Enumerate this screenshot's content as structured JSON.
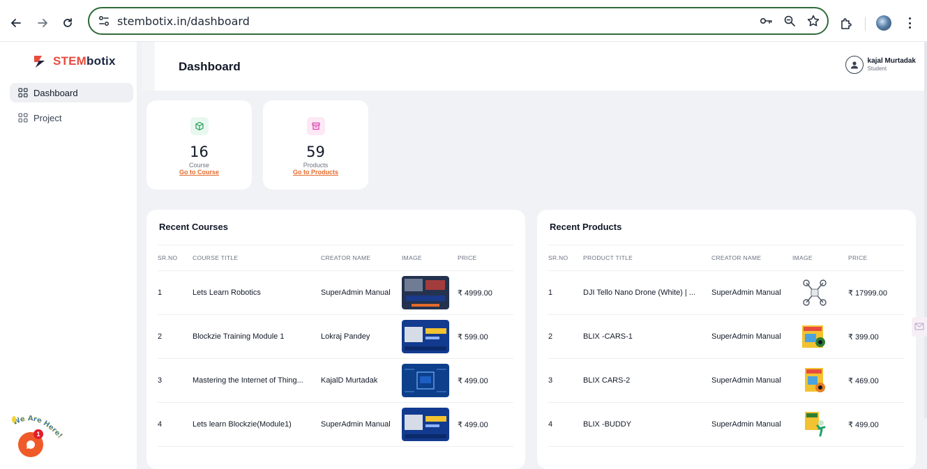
{
  "browser": {
    "url": "stembotix.in/dashboard"
  },
  "brand": {
    "part1": "STEM",
    "part2": "botix"
  },
  "sidebar": {
    "items": [
      {
        "label": "Dashboard",
        "active": true
      },
      {
        "label": "Project",
        "active": false
      }
    ],
    "chat_badge_count": "1",
    "chat_tagline": "We Are Here!"
  },
  "header": {
    "title": "Dashboard",
    "user_name": "kajal Murtadak",
    "user_role": "Student"
  },
  "stats": [
    {
      "value": "16",
      "label": "Course",
      "link": "Go to Course",
      "icon": "cube-icon",
      "color": "#e9f8ee"
    },
    {
      "value": "59",
      "label": "Products",
      "link": "Go to Products",
      "icon": "box-icon",
      "color": "#fde8f6"
    }
  ],
  "recent_courses": {
    "title": "Recent Courses",
    "columns": [
      "SR.NO",
      "COURSE TITLE",
      "CREATOR NAME",
      "IMAGE",
      "PRICE"
    ],
    "rows": [
      {
        "sr": "1",
        "title": "Lets Learn Robotics",
        "creator": "SuperAdmin Manual",
        "price": "₹ 4999.00",
        "image": "robotics"
      },
      {
        "sr": "2",
        "title": "Blockzie Training Module 1",
        "creator": "Lokraj Pandey",
        "price": "₹ 599.00",
        "image": "blockzie"
      },
      {
        "sr": "3",
        "title": "Mastering the Internet of Thing...",
        "creator": "KajalD Murtadak",
        "price": "₹ 499.00",
        "image": "iot"
      },
      {
        "sr": "4",
        "title": "Lets learn Blockzie(Module1)",
        "creator": "SuperAdmin Manual",
        "price": "₹ 499.00",
        "image": "blockzie"
      }
    ]
  },
  "recent_products": {
    "title": "Recent Products",
    "columns": [
      "SR.NO",
      "PRODUCT TITLE",
      "CREATOR NAME",
      "IMAGE",
      "PRICE"
    ],
    "rows": [
      {
        "sr": "1",
        "title": "DJI Tello Nano Drone (White) | ...",
        "creator": "SuperAdmin Manual",
        "price": "₹ 17999.00",
        "image": "drone"
      },
      {
        "sr": "2",
        "title": "BLIX -CARS-1",
        "creator": "SuperAdmin Manual",
        "price": "₹ 399.00",
        "image": "car-kit"
      },
      {
        "sr": "3",
        "title": "BLIX CARS-2",
        "creator": "SuperAdmin Manual",
        "price": "₹ 469.00",
        "image": "car-kit"
      },
      {
        "sr": "4",
        "title": "BLIX -BUDDY",
        "creator": "SuperAdmin Manual",
        "price": "₹ 499.00",
        "image": "buddy-kit"
      }
    ]
  },
  "colors": {
    "accent": "#e46a2b",
    "brand_red": "#e74c3c",
    "brand_navy": "#1a2540",
    "omnibox_border": "#2f6b3a",
    "background": "#f1f2f5"
  }
}
